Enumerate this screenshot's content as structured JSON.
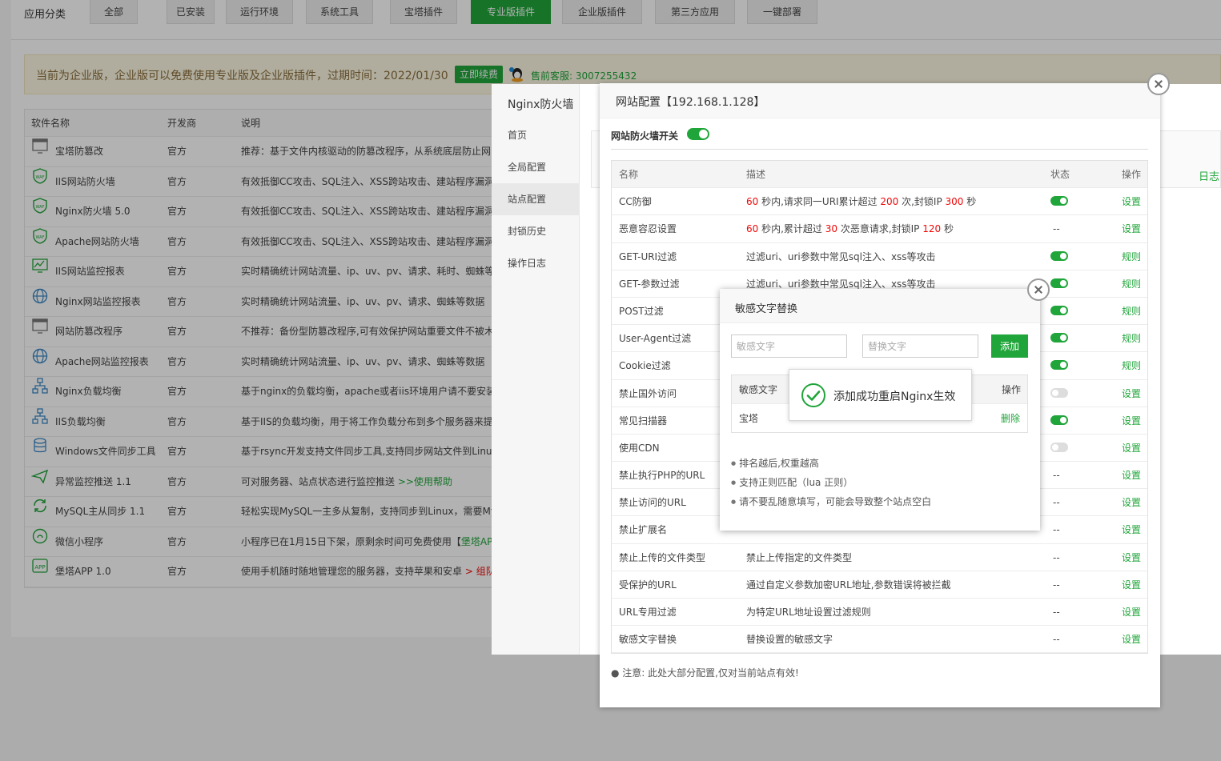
{
  "categories": {
    "title": "应用分类",
    "tabs": [
      {
        "label": "全部",
        "active": false
      },
      {
        "label": "已安装",
        "active": false
      },
      {
        "label": "运行环境",
        "active": false
      },
      {
        "label": "系统工具",
        "active": false
      },
      {
        "label": "宝塔插件",
        "active": false
      },
      {
        "label": "专业版插件",
        "active": true
      },
      {
        "label": "企业版插件",
        "active": false
      },
      {
        "label": "第三方应用",
        "active": false
      },
      {
        "label": "一键部署",
        "active": false
      }
    ]
  },
  "notice": {
    "text": "当前为企业版，企业版可以免费使用专业版及企业版插件，过期时间：2022/01/30",
    "renew_label": "立即续费",
    "service_text": "售前客服: 3007255432"
  },
  "software_table": {
    "headers": [
      "软件名称",
      "开发商",
      "说明"
    ],
    "rows": [
      {
        "name": "宝塔防篡改",
        "dev": "官方",
        "desc": "推荐：基于文件内核驱动的防篡改程序，从系统底层防止网",
        "icon": "monitor-icon"
      },
      {
        "name": "IIS网站防火墙",
        "dev": "官方",
        "desc": "有效抵御CC攻击、SQL注入、XSS跨站攻击、建站程序漏洞",
        "icon": "waf-shield-icon"
      },
      {
        "name": "Nginx防火墙 5.0",
        "dev": "官方",
        "desc": "有效抵御CC攻击、SQL注入、XSS跨站攻击、建站程序漏洞",
        "icon": "waf-shield-icon"
      },
      {
        "name": "Apache网站防火墙",
        "dev": "官方",
        "desc": "有效抵御CC攻击、SQL注入、XSS跨站攻击、建站程序漏洞",
        "icon": "waf-shield-icon"
      },
      {
        "name": "IIS网站监控报表",
        "dev": "官方",
        "desc": "实时精确统计网站流量、ip、uv、pv、请求、耗时、蜘蛛等",
        "icon": "chart-monitor-icon"
      },
      {
        "name": "Nginx网站监控报表",
        "dev": "官方",
        "desc": "实时精确统计网站流量、ip、uv、pv、请求、蜘蛛等数据",
        "icon": "globe-icon"
      },
      {
        "name": "网站防篡改程序",
        "dev": "官方",
        "desc": "不推荐：备份型防篡改程序,可有效保护网站重要文件不被木",
        "icon": "monitor-icon"
      },
      {
        "name": "Apache网站监控报表",
        "dev": "官方",
        "desc": "实时精确统计网站流量、ip、uv、pv、请求、蜘蛛等数据",
        "icon": "globe-icon"
      },
      {
        "name": "Nginx负载均衡",
        "dev": "官方",
        "desc": "基于nginx的负载均衡，apache或者iis环境用户请不要安装",
        "icon": "network-icon"
      },
      {
        "name": "IIS负载均衡",
        "dev": "官方",
        "desc": "基于IIS的负载均衡，用于将工作负载分布到多个服务器来提",
        "icon": "network-icon"
      },
      {
        "name": "Windows文件同步工具",
        "dev": "官方",
        "desc": "基于rsync开发支持文件同步工具,支持同步网站文件到Linux",
        "icon": "database-icon"
      },
      {
        "name": "异常监控推送 1.1",
        "dev": "官方",
        "desc": "可对服务器、站点状态进行监控推送 ",
        "desc_link": ">>使用帮助",
        "icon": "send-icon"
      },
      {
        "name": "MySQL主从同步 1.1",
        "dev": "官方",
        "desc": "轻松实现MySQL一主多从复制，支持同步到Linux，需要My",
        "icon": "sync-icon"
      },
      {
        "name": "微信小程序",
        "dev": "官方",
        "desc": "小程序已在1月15日下架，原剩余时间可免费使用【",
        "desc_link": "堡塔AP",
        "icon": "wechat-icon"
      },
      {
        "name": "堡塔APP 1.0",
        "dev": "官方",
        "desc": "使用手机随时随地管理您的服务器，支持苹果和安卓 ",
        "desc_red": "> 组队",
        "icon": "app-icon"
      }
    ]
  },
  "plugin": {
    "title": "Nginx防火墙",
    "nav": [
      {
        "label": "首页",
        "active": false
      },
      {
        "label": "全局配置",
        "active": false
      },
      {
        "label": "站点配置",
        "active": true
      },
      {
        "label": "封锁历史",
        "active": false
      },
      {
        "label": "操作日志",
        "active": false
      }
    ],
    "right_link": "日志"
  },
  "site_config": {
    "title": "网站配置【192.168.1.128】",
    "switch_label": "网站防火墙开关",
    "switch_on": true,
    "headers": [
      "名称",
      "描述",
      "状态",
      "操作"
    ],
    "rows": [
      {
        "name": "CC防御",
        "desc_parts": [
          [
            "60",
            true
          ],
          [
            " 秒内,请求同一URI累计超过 ",
            false
          ],
          [
            "200",
            true
          ],
          [
            " 次,封锁IP ",
            false
          ],
          [
            "300",
            true
          ],
          [
            " 秒",
            false
          ]
        ],
        "state": "on",
        "op": "设置"
      },
      {
        "name": "恶意容忍设置",
        "desc_parts": [
          [
            "60",
            true
          ],
          [
            " 秒内,累计超过 ",
            false
          ],
          [
            "30",
            true
          ],
          [
            " 次恶意请求,封锁IP ",
            false
          ],
          [
            "120",
            true
          ],
          [
            " 秒",
            false
          ]
        ],
        "state": "--",
        "op": "设置"
      },
      {
        "name": "GET-URI过滤",
        "desc_parts": [
          [
            "过滤uri、uri参数中常见sql注入、xss等攻击",
            false
          ]
        ],
        "state": "on",
        "op": "规则"
      },
      {
        "name": "GET-参数过滤",
        "desc_parts": [
          [
            "过滤uri、uri参数中常见sql注入、xss等攻击",
            false
          ]
        ],
        "state": "on",
        "op": "规则"
      },
      {
        "name": "POST过滤",
        "desc_parts": [
          [
            "",
            false
          ]
        ],
        "state": "on",
        "op": "规则"
      },
      {
        "name": "User-Agent过滤",
        "desc_parts": [
          [
            "",
            false
          ]
        ],
        "state": "on",
        "op": "规则"
      },
      {
        "name": "Cookie过滤",
        "desc_parts": [
          [
            "",
            false
          ]
        ],
        "state": "on",
        "op": "规则"
      },
      {
        "name": "禁止国外访问",
        "desc_parts": [
          [
            "",
            false
          ]
        ],
        "state": "off",
        "op": "设置"
      },
      {
        "name": "常见扫描器",
        "desc_parts": [
          [
            "",
            false
          ]
        ],
        "state": "on",
        "op": "设置"
      },
      {
        "name": "使用CDN",
        "desc_parts": [
          [
            "",
            false
          ]
        ],
        "state": "off",
        "op": "设置"
      },
      {
        "name": "禁止执行PHP的URL",
        "desc_parts": [
          [
            "",
            false
          ]
        ],
        "state": "--",
        "op": "设置"
      },
      {
        "name": "禁止访问的URL",
        "desc_parts": [
          [
            "",
            false
          ]
        ],
        "state": "--",
        "op": "设置"
      },
      {
        "name": "禁止扩展名",
        "desc_parts": [
          [
            "",
            false
          ]
        ],
        "state": "--",
        "op": "设置"
      },
      {
        "name": "禁止上传的文件类型",
        "desc_parts": [
          [
            "禁止上传指定的文件类型",
            false
          ]
        ],
        "state": "--",
        "op": "设置"
      },
      {
        "name": "受保护的URL",
        "desc_parts": [
          [
            "通过自定义参数加密URL地址,参数错误将被拦截",
            false
          ]
        ],
        "state": "--",
        "op": "设置"
      },
      {
        "name": "URL专用过滤",
        "desc_parts": [
          [
            "为特定URL地址设置过滤规则",
            false
          ]
        ],
        "state": "--",
        "op": "设置"
      },
      {
        "name": "敏感文字替换",
        "desc_parts": [
          [
            "替换设置的敏感文字",
            false
          ]
        ],
        "state": "--",
        "op": "设置"
      }
    ],
    "note": "注意: 此处大部分配置,仅对当前站点有效!"
  },
  "sensitive_dialog": {
    "title": "敏感文字替换",
    "input1_placeholder": "敏感文字",
    "input2_placeholder": "替换文字",
    "add_label": "添加",
    "headers": [
      "敏感文字",
      "操作"
    ],
    "rows": [
      {
        "text": "宝塔",
        "op": "删除"
      }
    ],
    "tips": [
      "排名越后,权重越高",
      "支持正则匹配（lua 正则）",
      "请不要乱随意填写，可能会导致整个站点空白"
    ]
  },
  "toast": {
    "text": "添加成功重启Nginx生效",
    "icon": "success-check-icon"
  },
  "colors": {
    "accent": "#20a53a",
    "danger": "#ef0808",
    "notice_bg": "#fcf8e3"
  }
}
